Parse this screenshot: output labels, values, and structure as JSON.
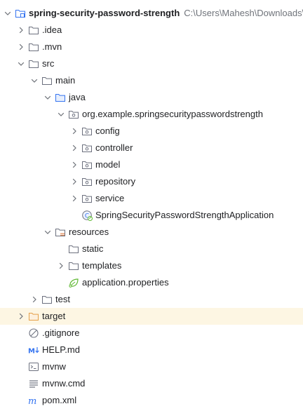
{
  "project": {
    "name": "spring-security-password-strength",
    "path": "C:\\Users\\Mahesh\\Downloads\\spring-security-password-strength"
  },
  "items": [
    {
      "label": "spring-security-password-strength",
      "depth": 0,
      "chevron": "down",
      "icon": "project-module-icon"
    },
    {
      "label": ".idea",
      "depth": 1,
      "chevron": "right",
      "icon": "folder-icon"
    },
    {
      "label": ".mvn",
      "depth": 1,
      "chevron": "right",
      "icon": "folder-icon"
    },
    {
      "label": "src",
      "depth": 1,
      "chevron": "down",
      "icon": "folder-icon"
    },
    {
      "label": "main",
      "depth": 2,
      "chevron": "down",
      "icon": "folder-icon"
    },
    {
      "label": "java",
      "depth": 3,
      "chevron": "down",
      "icon": "source-folder-icon"
    },
    {
      "label": "org.example.springsecuritypasswordstrength",
      "depth": 4,
      "chevron": "down",
      "icon": "package-icon"
    },
    {
      "label": "config",
      "depth": 5,
      "chevron": "right",
      "icon": "package-icon"
    },
    {
      "label": "controller",
      "depth": 5,
      "chevron": "right",
      "icon": "package-icon"
    },
    {
      "label": "model",
      "depth": 5,
      "chevron": "right",
      "icon": "package-icon"
    },
    {
      "label": "repository",
      "depth": 5,
      "chevron": "right",
      "icon": "package-icon"
    },
    {
      "label": "service",
      "depth": 5,
      "chevron": "right",
      "icon": "package-icon"
    },
    {
      "label": "SpringSecurityPasswordStrengthApplication",
      "depth": 5,
      "chevron": "none",
      "icon": "spring-boot-class-icon"
    },
    {
      "label": "resources",
      "depth": 3,
      "chevron": "down",
      "icon": "resources-folder-icon"
    },
    {
      "label": "static",
      "depth": 4,
      "chevron": "none",
      "icon": "folder-icon"
    },
    {
      "label": "templates",
      "depth": 4,
      "chevron": "right",
      "icon": "folder-icon"
    },
    {
      "label": "application.properties",
      "depth": 4,
      "chevron": "none",
      "icon": "spring-properties-icon"
    },
    {
      "label": "test",
      "depth": 2,
      "chevron": "right",
      "icon": "folder-icon"
    },
    {
      "label": "target",
      "depth": 1,
      "chevron": "right",
      "icon": "excluded-folder-icon",
      "highlight": true
    },
    {
      "label": ".gitignore",
      "depth": 1,
      "chevron": "none",
      "icon": "ignore-file-icon"
    },
    {
      "label": "HELP.md",
      "depth": 1,
      "chevron": "none",
      "icon": "markdown-icon"
    },
    {
      "label": "mvnw",
      "depth": 1,
      "chevron": "none",
      "icon": "shell-script-icon"
    },
    {
      "label": "mvnw.cmd",
      "depth": 1,
      "chevron": "none",
      "icon": "text-file-icon"
    },
    {
      "label": "pom.xml",
      "depth": 1,
      "chevron": "none",
      "icon": "maven-icon"
    }
  ],
  "colors": {
    "chevron": "#6f737a",
    "folder_stroke": "#6c707e",
    "source_folder": "#3574f0",
    "resources_accent": "#e08855",
    "excluded_folder": "#e5a14b",
    "spring_green": "#5fb832",
    "highlight_row": "#fdf6e3",
    "path_text": "#6f737a"
  }
}
